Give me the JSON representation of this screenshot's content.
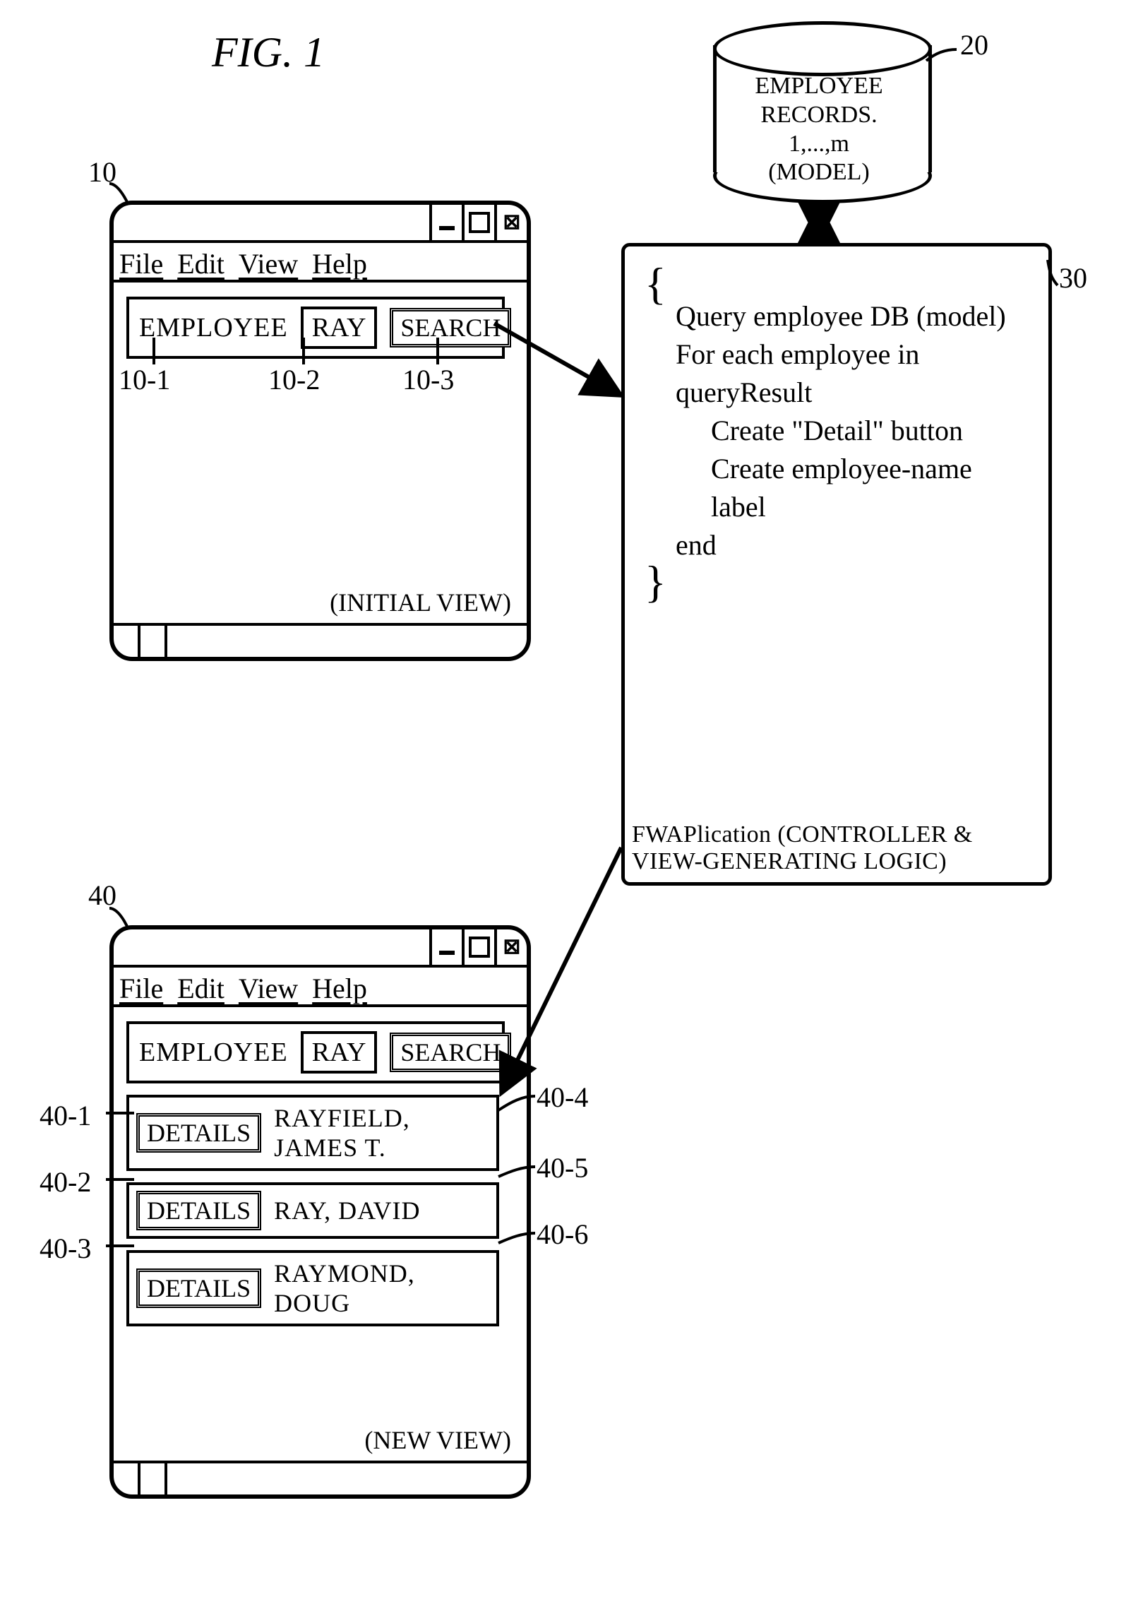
{
  "figure_title": "FIG. 1",
  "menu": {
    "file": "File",
    "edit": "Edit",
    "view": "View",
    "help": "Help"
  },
  "search": {
    "label": "EMPLOYEE",
    "value": "RAY",
    "button": "SEARCH"
  },
  "initial_view_label": "(INITIAL VIEW)",
  "new_view_label": "(NEW VIEW)",
  "details_label": "DETAILS",
  "results": [
    "RAYFIELD, JAMES T.",
    "RAY, DAVID",
    "RAYMOND, DOUG"
  ],
  "logic": {
    "l1": "Query employee DB (model)",
    "l2": "For each employee in queryResult",
    "l3": "Create \"Detail\" button",
    "l4": "Create employee-name label",
    "l5": "end",
    "caption": "FWAPlication (CONTROLLER & VIEW-GENERATING LOGIC)"
  },
  "db": {
    "line1": "EMPLOYEE",
    "line2": "RECORDS.",
    "line3": "1,...,m",
    "line4": "(MODEL)"
  },
  "refs": {
    "r10": "10",
    "r10_1": "10-1",
    "r10_2": "10-2",
    "r10_3": "10-3",
    "r20": "20",
    "r30": "30",
    "r40": "40",
    "r40_1": "40-1",
    "r40_2": "40-2",
    "r40_3": "40-3",
    "r40_4": "40-4",
    "r40_5": "40-5",
    "r40_6": "40-6"
  }
}
